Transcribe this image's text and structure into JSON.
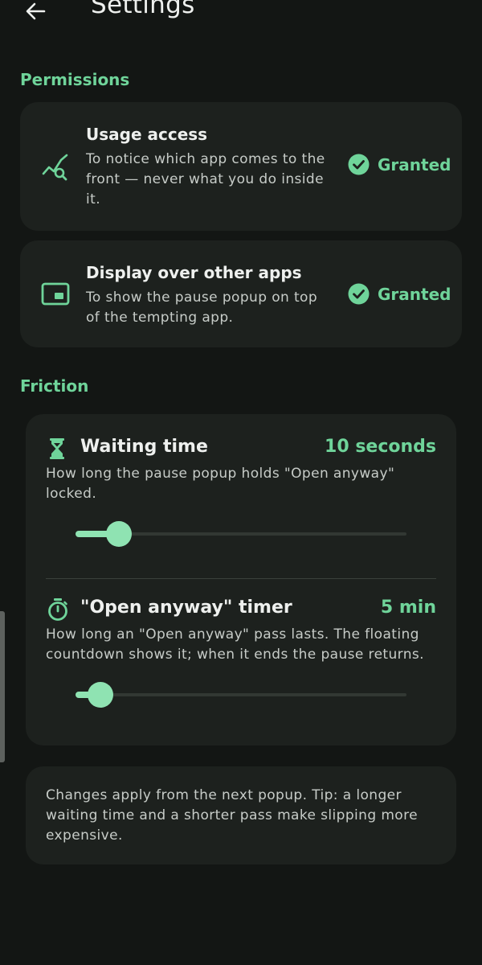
{
  "header": {
    "title": "Settings",
    "back_icon": "arrow-left-icon"
  },
  "permissions": {
    "section_title": "Permissions",
    "items": [
      {
        "icon": "usage-stats-icon",
        "title": "Usage access",
        "description": "To notice which app comes to the front — never what you do inside it.",
        "status": "Granted",
        "status_icon": "check-circle-icon"
      },
      {
        "icon": "picture-in-picture-icon",
        "title": "Display over other apps",
        "description": "To show the pause popup on top of the tempting app.",
        "status": "Granted",
        "status_icon": "check-circle-icon"
      }
    ]
  },
  "friction": {
    "section_title": "Friction",
    "waiting_time": {
      "icon": "hourglass-icon",
      "title": "Waiting time",
      "value": "10 seconds",
      "description": "How long the pause popup holds \"Open anyway\" locked.",
      "slider_fraction": 0.13
    },
    "open_anyway_timer": {
      "icon": "timer-icon",
      "title": "\"Open anyway\" timer",
      "value": "5 min",
      "description": "How long an \"Open anyway\" pass lasts. The floating countdown shows it; when it ends the pause returns.",
      "slider_fraction": 0.075
    }
  },
  "tip": {
    "text": "Changes apply from the next popup. Tip: a longer waiting time and a shorter pass make slipping more expensive."
  },
  "colors": {
    "background": "#131614",
    "card": "#1d211e",
    "accent": "#6fd49a",
    "slider_active": "#8fe3b2",
    "slider_track": "#323833"
  }
}
